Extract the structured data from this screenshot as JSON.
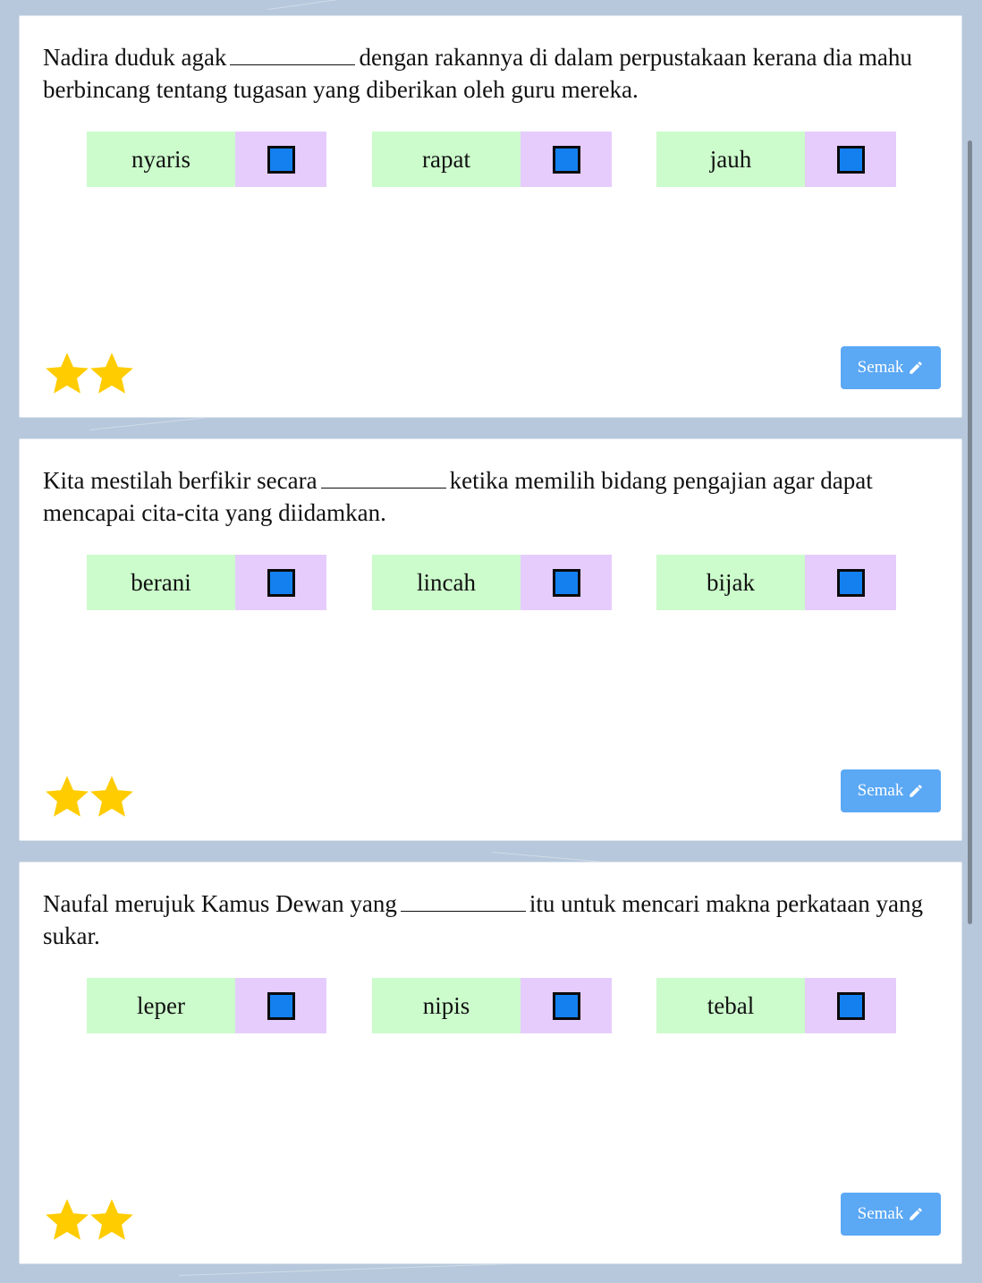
{
  "colors": {
    "background": "#b7c8dc",
    "option_label_bg": "#ccfccc",
    "option_check_bg": "#e5ccfc",
    "checkbox_fill": "#1480f0",
    "button_bg": "#5ba8f5",
    "star": "#ffcc00"
  },
  "questions": [
    {
      "text_before": "Nadira duduk agak",
      "text_after": "dengan rakannya di dalam perpustakaan kerana dia mahu berbincang tentang tugasan yang diberikan oleh guru mereka.",
      "options": [
        {
          "label": "nyaris",
          "checked": false
        },
        {
          "label": "rapat",
          "checked": false
        },
        {
          "label": "jauh",
          "checked": false
        }
      ],
      "stars": 2,
      "button_label": "Semak",
      "button_icon": "pencil-icon"
    },
    {
      "text_before": "Kita mestilah berfikir secara",
      "text_after": "ketika memilih bidang pengajian agar dapat mencapai cita-cita yang diidamkan.",
      "options": [
        {
          "label": "berani",
          "checked": false
        },
        {
          "label": "lincah",
          "checked": false
        },
        {
          "label": "bijak",
          "checked": false
        }
      ],
      "stars": 2,
      "button_label": "Semak",
      "button_icon": "pencil-icon"
    },
    {
      "text_before": "Naufal merujuk Kamus Dewan yang",
      "text_after": "itu untuk mencari makna perkataan yang sukar.",
      "options": [
        {
          "label": "leper",
          "checked": false
        },
        {
          "label": "nipis",
          "checked": false
        },
        {
          "label": "tebal",
          "checked": false
        }
      ],
      "stars": 2,
      "button_label": "Semak",
      "button_icon": "pencil-icon"
    }
  ]
}
